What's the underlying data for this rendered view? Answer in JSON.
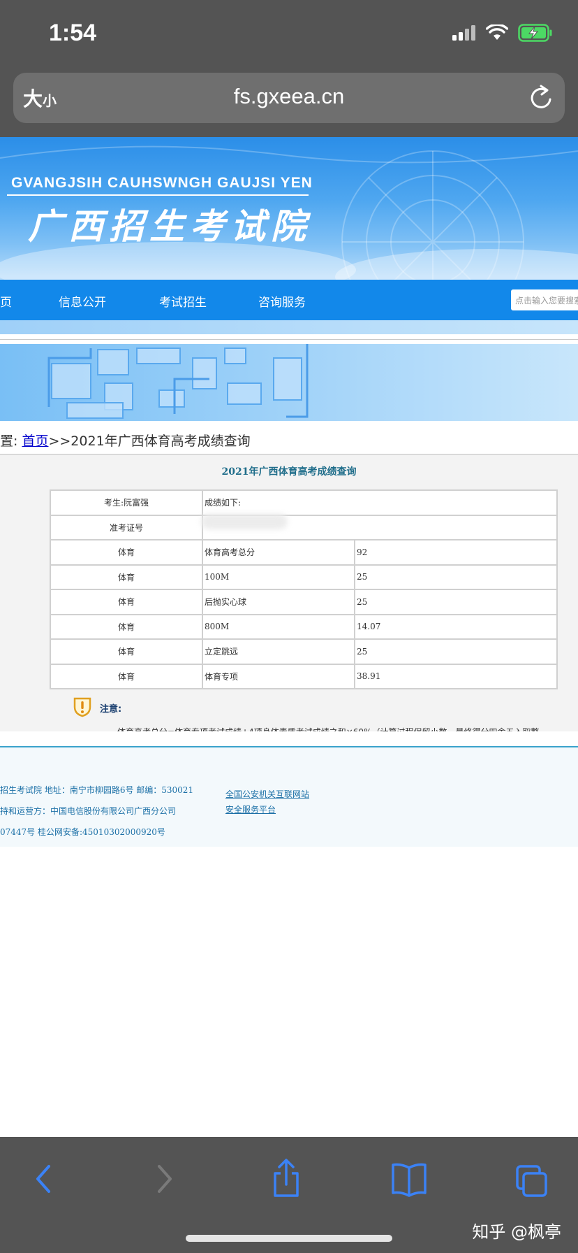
{
  "status_bar": {
    "time": "1:54"
  },
  "safari": {
    "aa_label_big": "大",
    "aa_label_small": "小",
    "url": "fs.gxeea.cn"
  },
  "site": {
    "banner_en": "GVANGJSIH CAUHSWNGH GAUJSI YEN",
    "banner_cn": "广西招生考试院",
    "nav": {
      "home_partial": "页",
      "items": [
        "信息公开",
        "考试招生",
        "咨询服务"
      ],
      "search_placeholder": "点击输入您要搜索"
    }
  },
  "breadcrumb": {
    "prefix": "置:",
    "home": "首页",
    "rest": ">>2021年广西体育高考成绩查询"
  },
  "result": {
    "title": "2021年广西体育高考成绩查询",
    "candidate": "考生:阮富强",
    "header_note": "成绩如下:",
    "exam_id_label": "准考证号",
    "rows": [
      {
        "category": "体育",
        "item": "体育高考总分",
        "score": "92"
      },
      {
        "category": "体育",
        "item": "100M",
        "score": "25"
      },
      {
        "category": "体育",
        "item": "后抛实心球",
        "score": "25"
      },
      {
        "category": "体育",
        "item": "800M",
        "score": "14.07"
      },
      {
        "category": "体育",
        "item": "立定跳远",
        "score": "25"
      },
      {
        "category": "体育",
        "item": "体育专项",
        "score": "38.91"
      }
    ],
    "notice_label": "注意:",
    "notice_text": "一　体育高考总分=体育专项考试成绩+4项身体素质考试成绩之和×60%（计算过程保留小数，最终得分四舍五入取整"
  },
  "footer": {
    "line1": "招生考试院 地址：南宁市柳园路6号 邮编：530021",
    "line2": "持和运营方：中国电信股份有限公司广西分公司",
    "line3": "07447号 桂公网安备:45010302000920号",
    "link1": "全国公安机关互联网站",
    "link2": "安全服务平台"
  },
  "watermark": "知乎 @枫亭",
  "colors": {
    "chrome": "#545454",
    "nav_blue": "#1288ea",
    "ios_blue": "#3b82f6",
    "battery_green": "#4cd964"
  }
}
